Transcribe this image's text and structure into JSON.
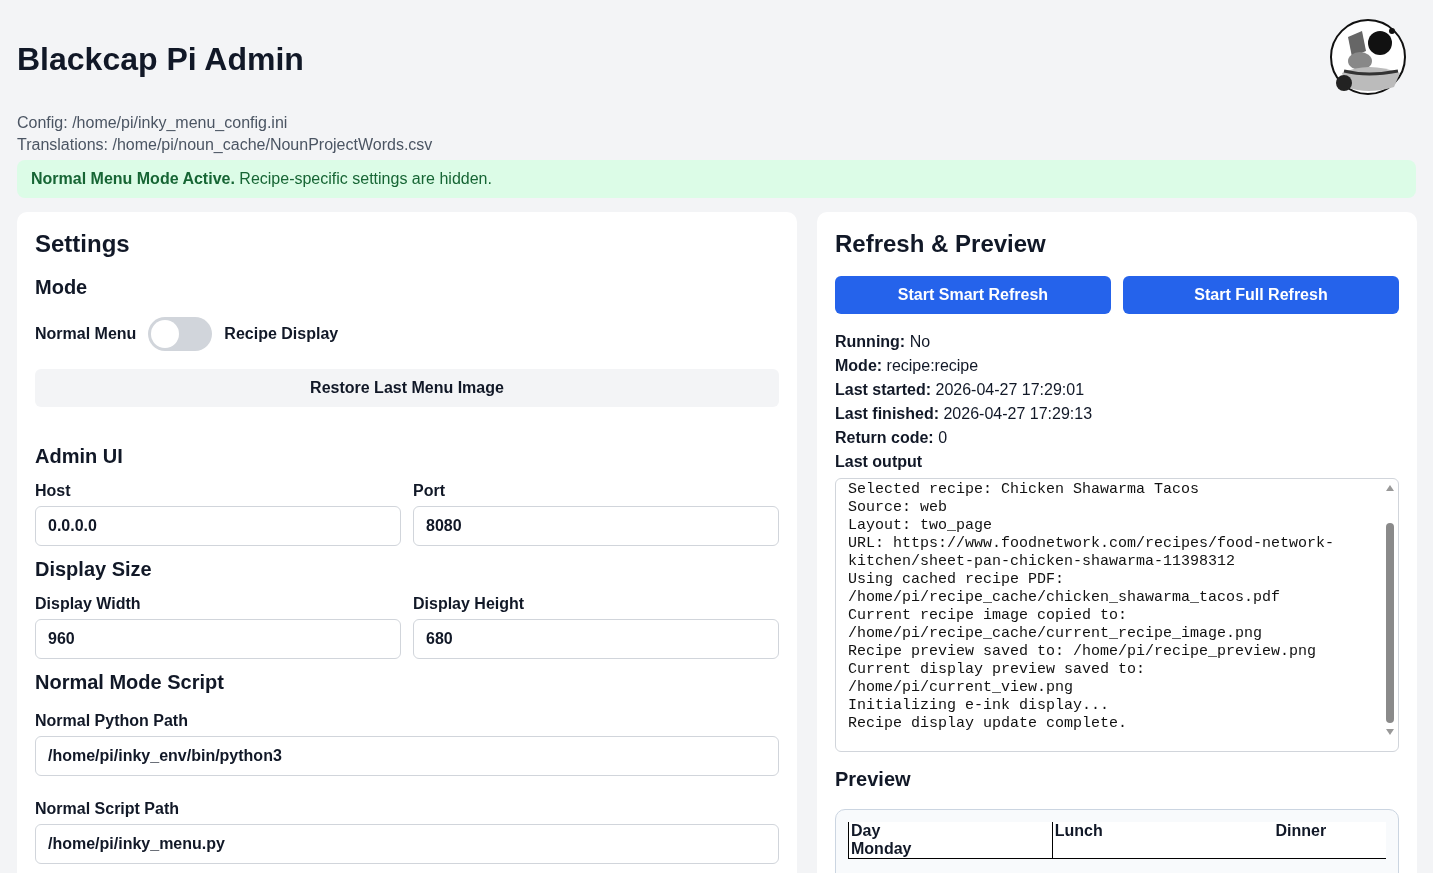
{
  "header": {
    "title": "Blackcap Pi Admin"
  },
  "paths": [
    "Config: /home/pi/inky_menu_config.ini",
    "Translations: /home/pi/noun_cache/NounProjectWords.csv"
  ],
  "notice": {
    "text": "**Normal Menu Mode Active.** Recipe-specific settings are hidden."
  },
  "settings": {
    "title": "Settings",
    "mode": {
      "heading": "Mode",
      "left_label": "Normal Menu",
      "right_label": "Recipe Display",
      "on": false,
      "button": "Restore Last Menu Image"
    },
    "sections": [
      {
        "heading": "Admin UI",
        "fields": [
          {
            "label": "Host",
            "value": "0.0.0.0"
          },
          {
            "label": "Port",
            "value": "8080"
          }
        ]
      },
      {
        "heading": "Display Size",
        "fields": [
          {
            "label": "Display Width",
            "value": "960"
          },
          {
            "label": "Display Height",
            "value": "680"
          }
        ]
      },
      {
        "heading": "Normal Mode Script",
        "fields": [
          {
            "label": "Normal Python Path",
            "value": "/home/pi/inky_env/bin/python3"
          },
          {
            "label": "Normal Script Path",
            "value": "/home/pi/inky_menu.py"
          }
        ]
      }
    ]
  },
  "refresh": {
    "title": "Refresh & Preview",
    "buttons": [
      "Start Smart Refresh",
      "Start Full Refresh"
    ],
    "status": [
      {
        "label": "Running:",
        "value": "No"
      },
      {
        "label": "Mode:",
        "value": "recipe:recipe"
      },
      {
        "label": "Last started:",
        "value": "2026-04-27 17:29:01"
      },
      {
        "label": "Last finished:",
        "value": "2026-04-27 17:29:13"
      },
      {
        "label": "Return code:",
        "value": "0"
      }
    ],
    "output_label": "Last output",
    "output": [
      "Selected recipe: Chicken Shawarma Tacos",
      "Source: web",
      "Layout: two_page",
      "URL: https://www.foodnetwork.com/recipes/food-network-",
      "kitchen/sheet-pan-chicken-shawarma-11398312",
      "Using cached recipe PDF:",
      "/home/pi/recipe_cache/chicken_shawarma_tacos.pdf",
      "Current recipe image copied to:",
      "/home/pi/recipe_cache/current_recipe_image.png",
      "Recipe preview saved to: /home/pi/recipe_preview.png",
      "Current display preview saved to:",
      "/home/pi/current_view.png",
      "Initializing e-ink display...",
      "Recipe display update complete."
    ],
    "preview_title": "Preview",
    "preview_table": {
      "columns": [
        "Day",
        "Lunch",
        "Dinner"
      ],
      "rows": [
        [
          "Monday",
          "",
          ""
        ]
      ]
    }
  }
}
